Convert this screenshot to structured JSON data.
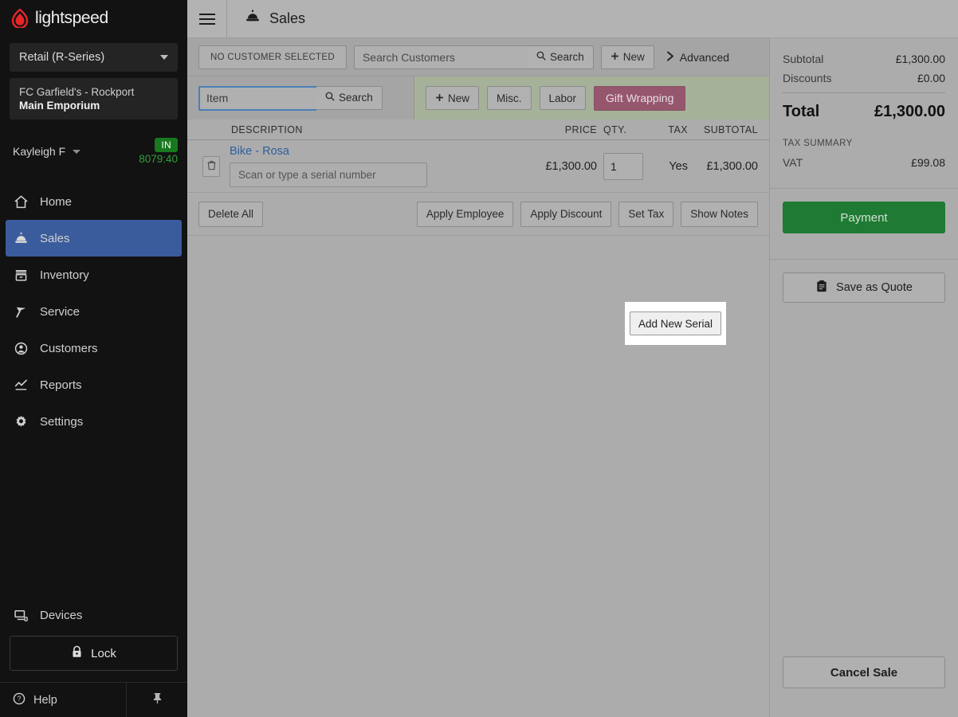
{
  "sidebar": {
    "brand": "lightspeed",
    "product_select": "Retail (R-Series)",
    "shop_line1": "FC Garfield's - Rockport",
    "shop_line2": "Main Emporium",
    "user_name": "Kayleigh F",
    "clock_badge": "IN",
    "clock_timer": "8079:40",
    "nav": [
      {
        "label": "Home",
        "icon": "home-icon",
        "active": false
      },
      {
        "label": "Sales",
        "icon": "bell-icon",
        "active": true
      },
      {
        "label": "Inventory",
        "icon": "box-icon",
        "active": false
      },
      {
        "label": "Service",
        "icon": "wrench-icon",
        "active": false
      },
      {
        "label": "Customers",
        "icon": "person-icon",
        "active": false
      },
      {
        "label": "Reports",
        "icon": "chart-icon",
        "active": false
      },
      {
        "label": "Settings",
        "icon": "gear-icon",
        "active": false
      }
    ],
    "devices_label": "Devices",
    "lock_label": "Lock",
    "help_label": "Help"
  },
  "topbar": {
    "title": "Sales"
  },
  "customer_bar": {
    "no_customer_label": "NO CUSTOMER SELECTED",
    "search_placeholder": "Search Customers",
    "search_value": "",
    "search_button": "Search",
    "new_button": "New",
    "advanced_label": "Advanced"
  },
  "item_bar": {
    "item_placeholder": "Item",
    "item_value": "",
    "search_button": "Search",
    "new_button": "New",
    "misc_button": "Misc.",
    "labor_button": "Labor",
    "gift_wrapping_button": "Gift Wrapping"
  },
  "table": {
    "headers": {
      "description": "DESCRIPTION",
      "price": "PRICE",
      "qty": "QTY.",
      "tax": "TAX",
      "subtotal": "SUBTOTAL"
    },
    "rows": [
      {
        "title": "Bike - Rosa",
        "serial_placeholder": "Scan or type a serial number",
        "serial_value": "",
        "add_serial_button": "Add New Serial",
        "price": "£1,300.00",
        "qty": "1",
        "tax": "Yes",
        "subtotal": "£1,300.00"
      }
    ]
  },
  "actions": {
    "delete_all": "Delete All",
    "apply_employee": "Apply Employee",
    "apply_discount": "Apply Discount",
    "set_tax": "Set Tax",
    "show_notes": "Show Notes"
  },
  "totals": {
    "subtotal_label": "Subtotal",
    "subtotal_value": "£1,300.00",
    "discounts_label": "Discounts",
    "discounts_value": "£0.00",
    "total_label": "Total",
    "total_value": "£1,300.00",
    "tax_summary_label": "TAX SUMMARY",
    "vat_label": "VAT",
    "vat_value": "£99.08"
  },
  "right_actions": {
    "payment": "Payment",
    "save_as_quote": "Save as Quote",
    "cancel_sale": "Cancel Sale"
  },
  "colors": {
    "brand_red": "#e8262a",
    "nav_active": "#3b5c9c",
    "payment_green": "#1f7a33",
    "gift_mauve": "#96576e",
    "item_bar_green": "#a5b299",
    "link_blue": "#2e5f9e",
    "clock_green": "#2fa03a"
  }
}
